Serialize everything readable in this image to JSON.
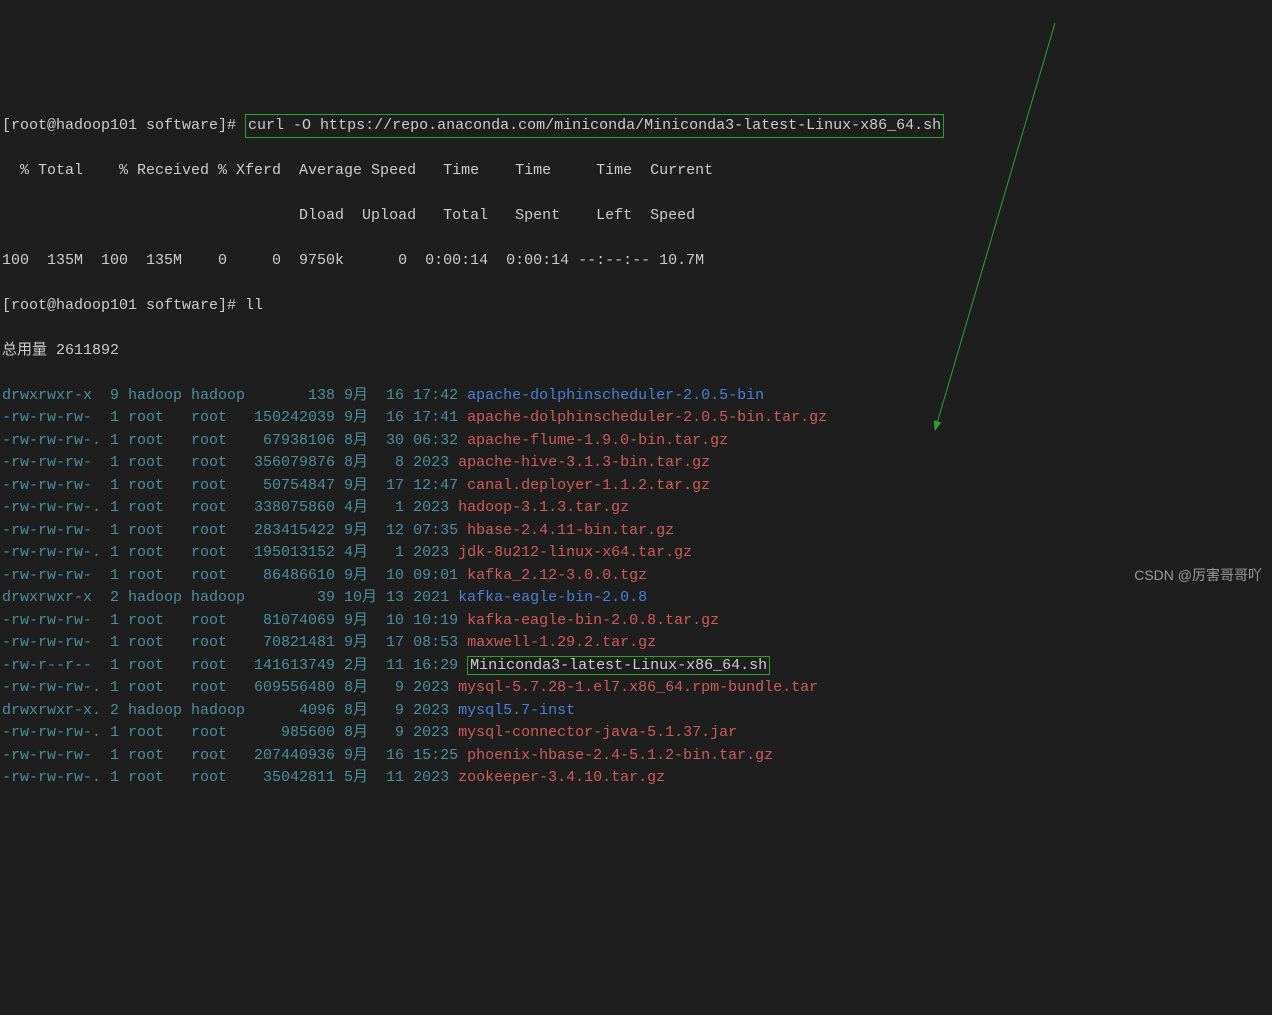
{
  "prompt1": "[root@hadoop101 software]# ",
  "curl_cmd": "curl -O https://repo.anaconda.com/miniconda/Miniconda3-latest-Linux-x86_64.sh",
  "curl_header1": "  % Total    % Received % Xferd  Average Speed   Time    Time     Time  Current",
  "curl_header2": "                                 Dload  Upload   Total   Spent    Left  Speed",
  "curl_progress": "100  135M  100  135M    0     0  9750k      0  0:00:14  0:00:14 --:--:-- 10.7M",
  "prompt2": "[root@hadoop101 software]# ",
  "ll_cmd": "ll",
  "total_line": "总用量 2611892",
  "files": [
    {
      "perm": "drwxrwxr-x ",
      "links": " 9 ",
      "owner": "hadoop ",
      "group": "hadoop ",
      "size": "      138 ",
      "month": "9月 ",
      "day": " 16 ",
      "time": "17:42 ",
      "name": "apache-dolphinscheduler-2.0.5-bin",
      "color": "blue"
    },
    {
      "perm": "-rw-rw-rw- ",
      "links": " 1 ",
      "owner": "root   ",
      "group": "root   ",
      "size": "150242039 ",
      "month": "9月 ",
      "day": " 16 ",
      "time": "17:41 ",
      "name": "apache-dolphinscheduler-2.0.5-bin.tar.gz",
      "color": "red"
    },
    {
      "perm": "-rw-rw-rw-.",
      "links": " 1 ",
      "owner": "root   ",
      "group": "root   ",
      "size": " 67938106 ",
      "month": "8月 ",
      "day": " 30 ",
      "time": "06:32 ",
      "name": "apache-flume-1.9.0-bin.tar.gz",
      "color": "red"
    },
    {
      "perm": "-rw-rw-rw- ",
      "links": " 1 ",
      "owner": "root   ",
      "group": "root   ",
      "size": "356079876 ",
      "month": "8月 ",
      "day": "  8 ",
      "time": "2023 ",
      "name": "apache-hive-3.1.3-bin.tar.gz",
      "color": "red"
    },
    {
      "perm": "-rw-rw-rw- ",
      "links": " 1 ",
      "owner": "root   ",
      "group": "root   ",
      "size": " 50754847 ",
      "month": "9月 ",
      "day": " 17 ",
      "time": "12:47 ",
      "name": "canal.deployer-1.1.2.tar.gz",
      "color": "red"
    },
    {
      "perm": "-rw-rw-rw-.",
      "links": " 1 ",
      "owner": "root   ",
      "group": "root   ",
      "size": "338075860 ",
      "month": "4月 ",
      "day": "  1 ",
      "time": "2023 ",
      "name": "hadoop-3.1.3.tar.gz",
      "color": "red"
    },
    {
      "perm": "-rw-rw-rw- ",
      "links": " 1 ",
      "owner": "root   ",
      "group": "root   ",
      "size": "283415422 ",
      "month": "9月 ",
      "day": " 12 ",
      "time": "07:35 ",
      "name": "hbase-2.4.11-bin.tar.gz",
      "color": "red"
    },
    {
      "perm": "-rw-rw-rw-.",
      "links": " 1 ",
      "owner": "root   ",
      "group": "root   ",
      "size": "195013152 ",
      "month": "4月 ",
      "day": "  1 ",
      "time": "2023 ",
      "name": "jdk-8u212-linux-x64.tar.gz",
      "color": "red"
    },
    {
      "perm": "-rw-rw-rw- ",
      "links": " 1 ",
      "owner": "root   ",
      "group": "root   ",
      "size": " 86486610 ",
      "month": "9月 ",
      "day": " 10 ",
      "time": "09:01 ",
      "name": "kafka_2.12-3.0.0.tgz",
      "color": "red"
    },
    {
      "perm": "drwxrwxr-x ",
      "links": " 2 ",
      "owner": "hadoop ",
      "group": "hadoop ",
      "size": "       39 ",
      "month": "10月",
      "day": " 13 ",
      "time": "2021 ",
      "name": "kafka-eagle-bin-2.0.8",
      "color": "blue"
    },
    {
      "perm": "-rw-rw-rw- ",
      "links": " 1 ",
      "owner": "root   ",
      "group": "root   ",
      "size": " 81074069 ",
      "month": "9月 ",
      "day": " 10 ",
      "time": "10:19 ",
      "name": "kafka-eagle-bin-2.0.8.tar.gz",
      "color": "red"
    },
    {
      "perm": "-rw-rw-rw- ",
      "links": " 1 ",
      "owner": "root   ",
      "group": "root   ",
      "size": " 70821481 ",
      "month": "9月 ",
      "day": " 17 ",
      "time": "08:53 ",
      "name": "maxwell-1.29.2.tar.gz",
      "color": "red"
    },
    {
      "perm": "-rw-r--r-- ",
      "links": " 1 ",
      "owner": "root   ",
      "group": "root   ",
      "size": "141613749 ",
      "month": "2月 ",
      "day": " 11 ",
      "time": "16:29 ",
      "name": "Miniconda3-latest-Linux-x86_64.sh",
      "color": "white",
      "boxed": true
    },
    {
      "perm": "-rw-rw-rw-.",
      "links": " 1 ",
      "owner": "root   ",
      "group": "root   ",
      "size": "609556480 ",
      "month": "8月 ",
      "day": "  9 ",
      "time": "2023 ",
      "name": "mysql-5.7.28-1.el7.x86_64.rpm-bundle.tar",
      "color": "red"
    },
    {
      "perm": "drwxrwxr-x.",
      "links": " 2 ",
      "owner": "hadoop ",
      "group": "hadoop ",
      "size": "     4096 ",
      "month": "8月 ",
      "day": "  9 ",
      "time": "2023 ",
      "name": "mysql5.7-inst",
      "color": "blue"
    },
    {
      "perm": "-rw-rw-rw-.",
      "links": " 1 ",
      "owner": "root   ",
      "group": "root   ",
      "size": "   985600 ",
      "month": "8月 ",
      "day": "  9 ",
      "time": "2023 ",
      "name": "mysql-connector-java-5.1.37.jar",
      "color": "red"
    },
    {
      "perm": "-rw-rw-rw- ",
      "links": " 1 ",
      "owner": "root   ",
      "group": "root   ",
      "size": "207440936 ",
      "month": "9月 ",
      "day": " 16 ",
      "time": "15:25 ",
      "name": "phoenix-hbase-2.4-5.1.2-bin.tar.gz",
      "color": "red"
    },
    {
      "perm": "-rw-rw-rw-.",
      "links": " 1 ",
      "owner": "root   ",
      "group": "root   ",
      "size": " 35042811 ",
      "month": "5月 ",
      "day": " 11 ",
      "time": "2023 ",
      "name": "zookeeper-3.4.10.tar.gz",
      "color": "red"
    }
  ],
  "watermark": "CSDN @厉害哥哥吖"
}
